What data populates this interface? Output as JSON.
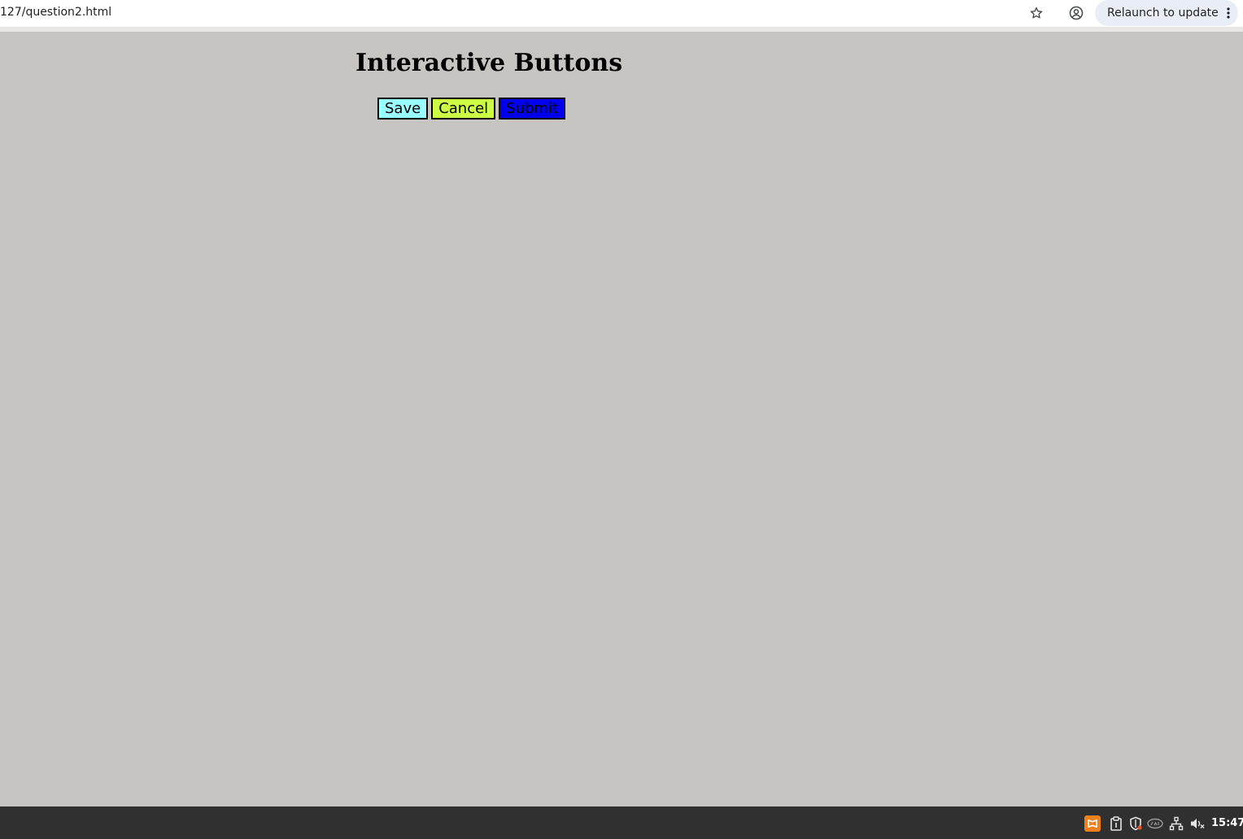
{
  "browser": {
    "url": "127/question2.html",
    "relaunch_label": "Relaunch to update",
    "icons": {
      "bookmark": "star-icon",
      "profile": "profile-icon",
      "menu": "menu-dots-icon"
    }
  },
  "page": {
    "title": "Interactive Buttons",
    "background": "#c6c5c1",
    "buttons": [
      {
        "label": "Save",
        "color": "#99ffff"
      },
      {
        "label": "Cancel",
        "color": "#ccff44"
      },
      {
        "label": "Submit",
        "color": "#0000ee"
      }
    ]
  },
  "taskbar": {
    "time": "15:47",
    "tray_icons": [
      "app-icon",
      "clipboard-icon",
      "shield-icon",
      "intel-icon",
      "network-icon",
      "volume-muted-icon"
    ]
  }
}
